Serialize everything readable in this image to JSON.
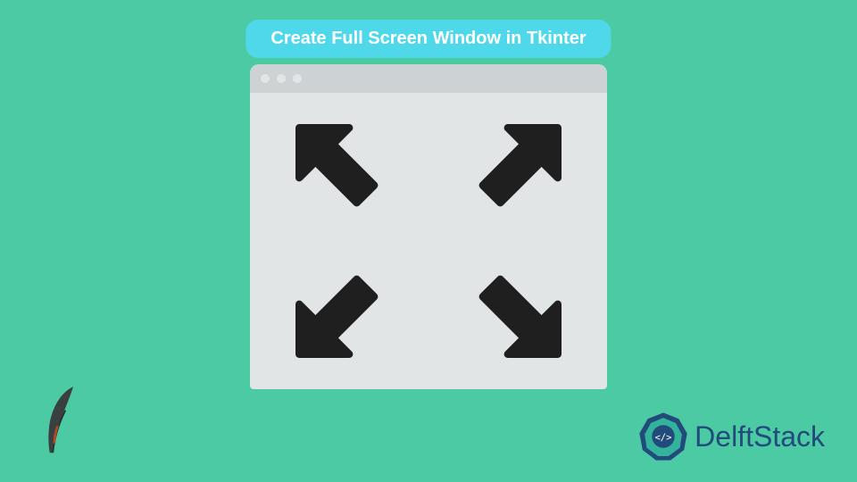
{
  "title": "Create Full Screen Window in Tkinter",
  "brand": {
    "name": "DelftStack"
  },
  "colors": {
    "background": "#4bcaa4",
    "pill": "#4fd8ea",
    "window_body": "#e1e5e6",
    "window_titlebar": "#cdd3d4",
    "arrows": "#1f1f1f",
    "brand_primary": "#224a7a",
    "brand_accent": "#33b39b"
  },
  "icons": {
    "expand": "expand-icon",
    "feather": "feather-icon",
    "logo_mark": "delftstack-logo-mark"
  }
}
